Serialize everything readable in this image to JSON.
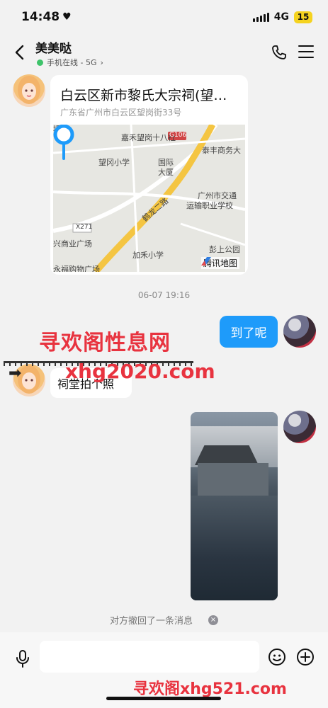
{
  "status_bar": {
    "time": "14:48",
    "heart": "♥",
    "network": "4G",
    "battery": "15"
  },
  "header": {
    "contact_name": "美美哒",
    "contact_status": "手机在线 - 5G",
    "status_chevron": "›",
    "icons": {
      "back": "chevron-left-icon",
      "call": "phone-icon",
      "menu": "menu-icon"
    }
  },
  "messages": {
    "location": {
      "title": "白云区新市黎氏大宗祠(望…",
      "address": "广东省广州市白云区望岗街33号",
      "map_labels": {
        "top_street": "場",
        "jiahe": "嘉禾望岗十八社",
        "g106": "G106",
        "taifeng": "泰丰商务大",
        "wanggang_school": "望冈小学",
        "international": "国际",
        "building": "大厦",
        "jiaotong": "广州市交通",
        "yunshu": "运输职业学校",
        "hecheng_road": "鹤龙二路",
        "x271": "X271",
        "xing_plaza": "兴商业广场",
        "jiahe_school": "加禾小学",
        "pengshang": "彭上公园",
        "bottom_left": "永福购物广场"
      },
      "map_provider": "腾讯地图"
    },
    "timestamp": "06-07 19:16",
    "sent_text": "到了呢",
    "received_text": "祠堂拍个照",
    "recall_notice": "对方撤回了一条消息",
    "recall_close": "×"
  },
  "watermarks": {
    "top": "寻欢阁性息网",
    "middle": "xhg2020.com",
    "bottom": "寻欢阁xhg521.com"
  },
  "input_bar": {
    "placeholder": "",
    "icons": {
      "voice": "mic-icon",
      "emoji": "emoji-icon",
      "more": "plus-icon"
    }
  },
  "colors": {
    "accent": "#1e9bfa",
    "online": "#3ec36a",
    "watermark": "#e8333f",
    "background": "#f2f2f2"
  }
}
